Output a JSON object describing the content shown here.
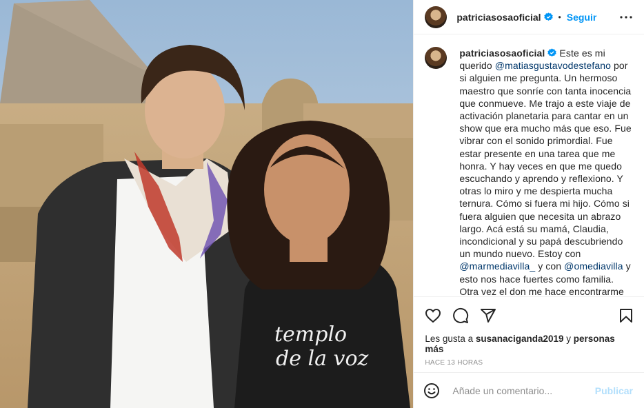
{
  "post": {
    "username": "patriciasosaoficial",
    "follow_label": "Seguir",
    "separator": "•",
    "caption_user": "patriciasosaoficial",
    "caption_part1": " Este es mi querido ",
    "mention1": "@matiasgustavodestefano",
    "caption_part2": " por si alguien me pregunta. Un hermoso maestro que sonríe con tanta inocencia que conmueve. Me trajo a este viaje de activación planetaria para cantar en un show que era mucho más que eso. Fue vibrar con el sonido primordial. Fue estar presente en una tarea que me honra. Y hay veces en que me quedo escuchando y aprendo y reflexiono. Y otras lo miro y me despierta mucha ternura. Cómo si fuera mi hijo. Cómo si fuera alguien que necesita un abrazo largo. Acá está su mamá, Claudia, incondicional y su papá descubriendo un mundo nuevo. Estoy con ",
    "mention2": "@marmediavilla_",
    "caption_part3": " y con ",
    "mention3": "@omediavilla",
    "caption_part4": " y esto nos hace fuertes como familia. Otra vez el don me hace encontrarme donde más amo. @t...",
    "likes_prefix": "Les gusta a ",
    "likes_user": "susanaciganda2019",
    "likes_mid": " y ",
    "likes_others": "personas más",
    "timestamp": "HACE 13 HORAS",
    "comment_placeholder": "Añade un comentario...",
    "publish_label": "Publicar",
    "shirt_line1": "templo",
    "shirt_line2": "de la voz"
  },
  "icons": {
    "verified": "verified-badge-icon",
    "more": "more-options-icon",
    "like": "heart-icon",
    "comment": "comment-icon",
    "share": "send-icon",
    "save": "bookmark-icon",
    "emoji": "emoji-icon"
  },
  "colors": {
    "link_blue": "#0095f6",
    "mention": "#00376b",
    "publish_disabled": "#b2dffc",
    "muted": "#8e8e8e"
  }
}
